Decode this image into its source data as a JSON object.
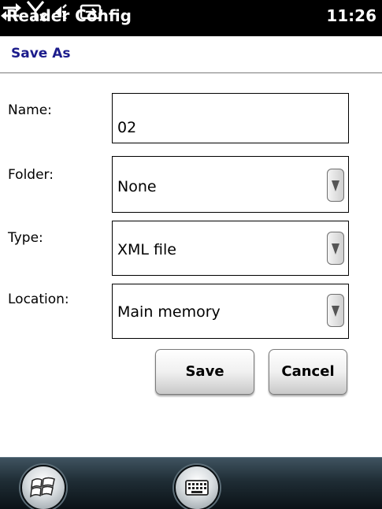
{
  "status_bar": {
    "app_title": "Reader Config",
    "time": "11:26",
    "icons": [
      "sync-arrows-icon",
      "no-signal-icon",
      "speaker-icon",
      "battery-icon"
    ]
  },
  "page": {
    "title": "Save As"
  },
  "form": {
    "name_label": "Name:",
    "name_value": "02",
    "folder_label": "Folder:",
    "folder_value": "None",
    "type_label": "Type:",
    "type_value": "XML file",
    "location_label": "Location:",
    "location_value": "Main memory"
  },
  "buttons": {
    "save": "Save",
    "cancel": "Cancel"
  },
  "bottom_bar": {
    "icons": [
      "windows-start-icon",
      "keyboard-icon"
    ]
  }
}
